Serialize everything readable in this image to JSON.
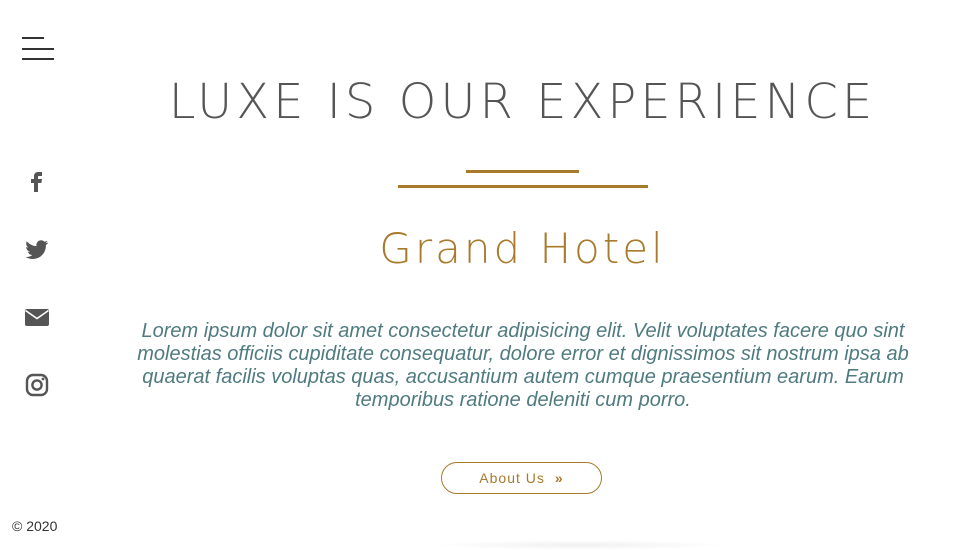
{
  "nav": {
    "menu_icon": "hamburger-menu-icon"
  },
  "social": {
    "items": [
      {
        "name": "facebook",
        "icon": "facebook-icon"
      },
      {
        "name": "twitter",
        "icon": "twitter-icon"
      },
      {
        "name": "email",
        "icon": "envelope-icon"
      },
      {
        "name": "instagram",
        "icon": "instagram-icon"
      }
    ]
  },
  "hero": {
    "headline": "LUXE IS OUR EXPERIENCE",
    "subtitle": "Grand Hotel",
    "lead": "Lorem ipsum dolor sit amet consectetur adipisicing elit. Velit voluptates facere quo sint molestias officiis cupiditate consequatur, dolore error et dignissimos sit nostrum ipsa ab quaerat facilis voluptas quas, accusantium autem cumque praesentium earum. Earum temporibus ratione deleniti cum porro.",
    "button_label": "About Us",
    "button_icon": "double-chevron-right-icon"
  },
  "footer": {
    "copyright": "© 2020"
  },
  "colors": {
    "accent": "#a87a2c",
    "text_dark": "#555555",
    "lead_text": "#4f7b80",
    "icon": "#555555"
  }
}
